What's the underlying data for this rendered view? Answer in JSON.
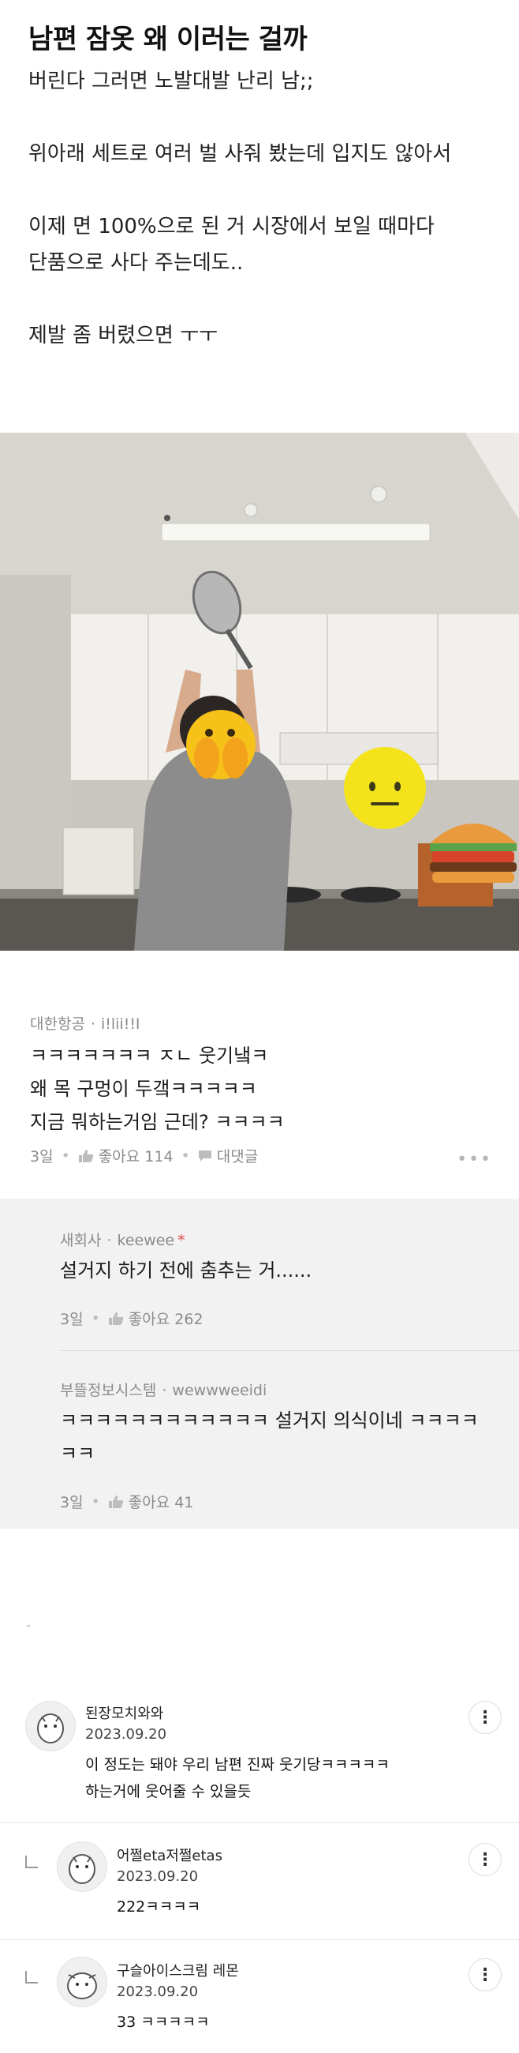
{
  "post": {
    "title": "남편 잠옷 왜 이러는 걸까",
    "lines": [
      "버린다 그러면 노발대발 난리 남;;",
      "",
      "위아래 세트로 여러 벌 사줘 봤는데 입지도 않아서",
      "",
      "이제 면 100%으로 된 거 시장에서 보일 때마다",
      "단품으로 사다 주는데도..",
      "",
      "제발 좀 버렸으면 ㅜㅜ"
    ],
    "photo": {
      "description_icon": "kitchen-photo",
      "stickers": [
        "face-with-hands-emoji",
        "neutral-face-emoji",
        "hamburger-emoji"
      ]
    }
  },
  "embedded_comment": {
    "company": "대한항공",
    "author": "i!lii!!I",
    "body": [
      "ㅋㅋㅋㅋㅋㅋㅋ ㅈㄴ 웃기냌ㅋ",
      "왜 목 구멍이 두갴ㅋㅋㅋㅋㅋ",
      "지금 뭐하는거임 근데? ㅋㅋㅋㅋ"
    ],
    "time": "3일",
    "like_label": "좋아요 114",
    "reply_label": "대댓글",
    "replies": [
      {
        "company": "새회사",
        "author": "keewee",
        "author_mark": "*",
        "body": [
          "설거지 하기 전에 춤추는 거......"
        ],
        "time": "3일",
        "like_label": "좋아요 262"
      },
      {
        "company": "부뜰정보시스템",
        "author": "wewwweeidi",
        "body": [
          "ㅋㅋㅋㅋㅋㅋㅋㅋㅋㅋㅋㅋ 설거지 의식이네 ㅋㅋㅋㅋ",
          "ㅋㅋ"
        ],
        "time": "3일",
        "like_label": "좋아요 41"
      }
    ]
  },
  "comments": [
    {
      "nickname": "된장모치와와",
      "date": "2023.09.20",
      "text": [
        "이 정도는 돼야 우리 남편 진짜 웃기당ㅋㅋㅋㅋㅋ",
        "하는거에 웃어줄 수 있을듯"
      ],
      "is_reply": false
    },
    {
      "nickname": "어쩔eta저쩔etas",
      "date": "2023.09.20",
      "text": [
        "222ㅋㅋㅋㅋ"
      ],
      "is_reply": true
    },
    {
      "nickname": "구슬아이스크림 레몬",
      "date": "2023.09.20",
      "text": [
        "33 ㅋㅋㅋㅋㅋ"
      ],
      "is_reply": true
    }
  ],
  "colors": {
    "accent_star": "#e8474f",
    "reply_background": "#f2f2f2",
    "meta_gray": "#8b8b8b"
  }
}
